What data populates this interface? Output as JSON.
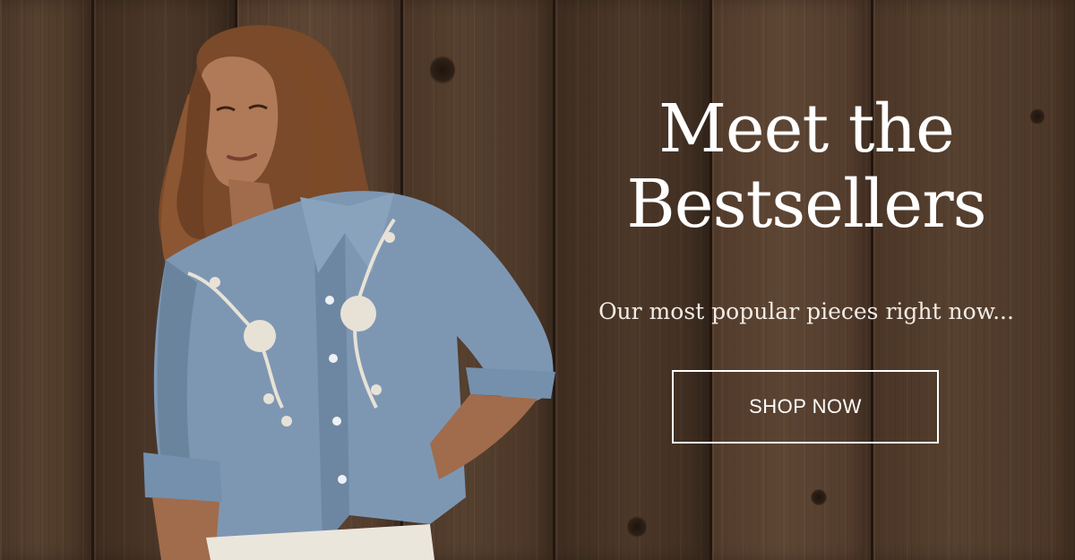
{
  "banner": {
    "headline_line1": "Meet the",
    "headline_line2": "Bestsellers",
    "subheadline": "Our most popular pieces right now...",
    "cta_label": "SHOP NOW"
  },
  "colors": {
    "text": "#ffffff",
    "wood_dark": "#3a2a1f",
    "wood_light": "#5e4634",
    "shirt_denim": "#7d97b3",
    "embroidery": "#e8e2d6"
  }
}
